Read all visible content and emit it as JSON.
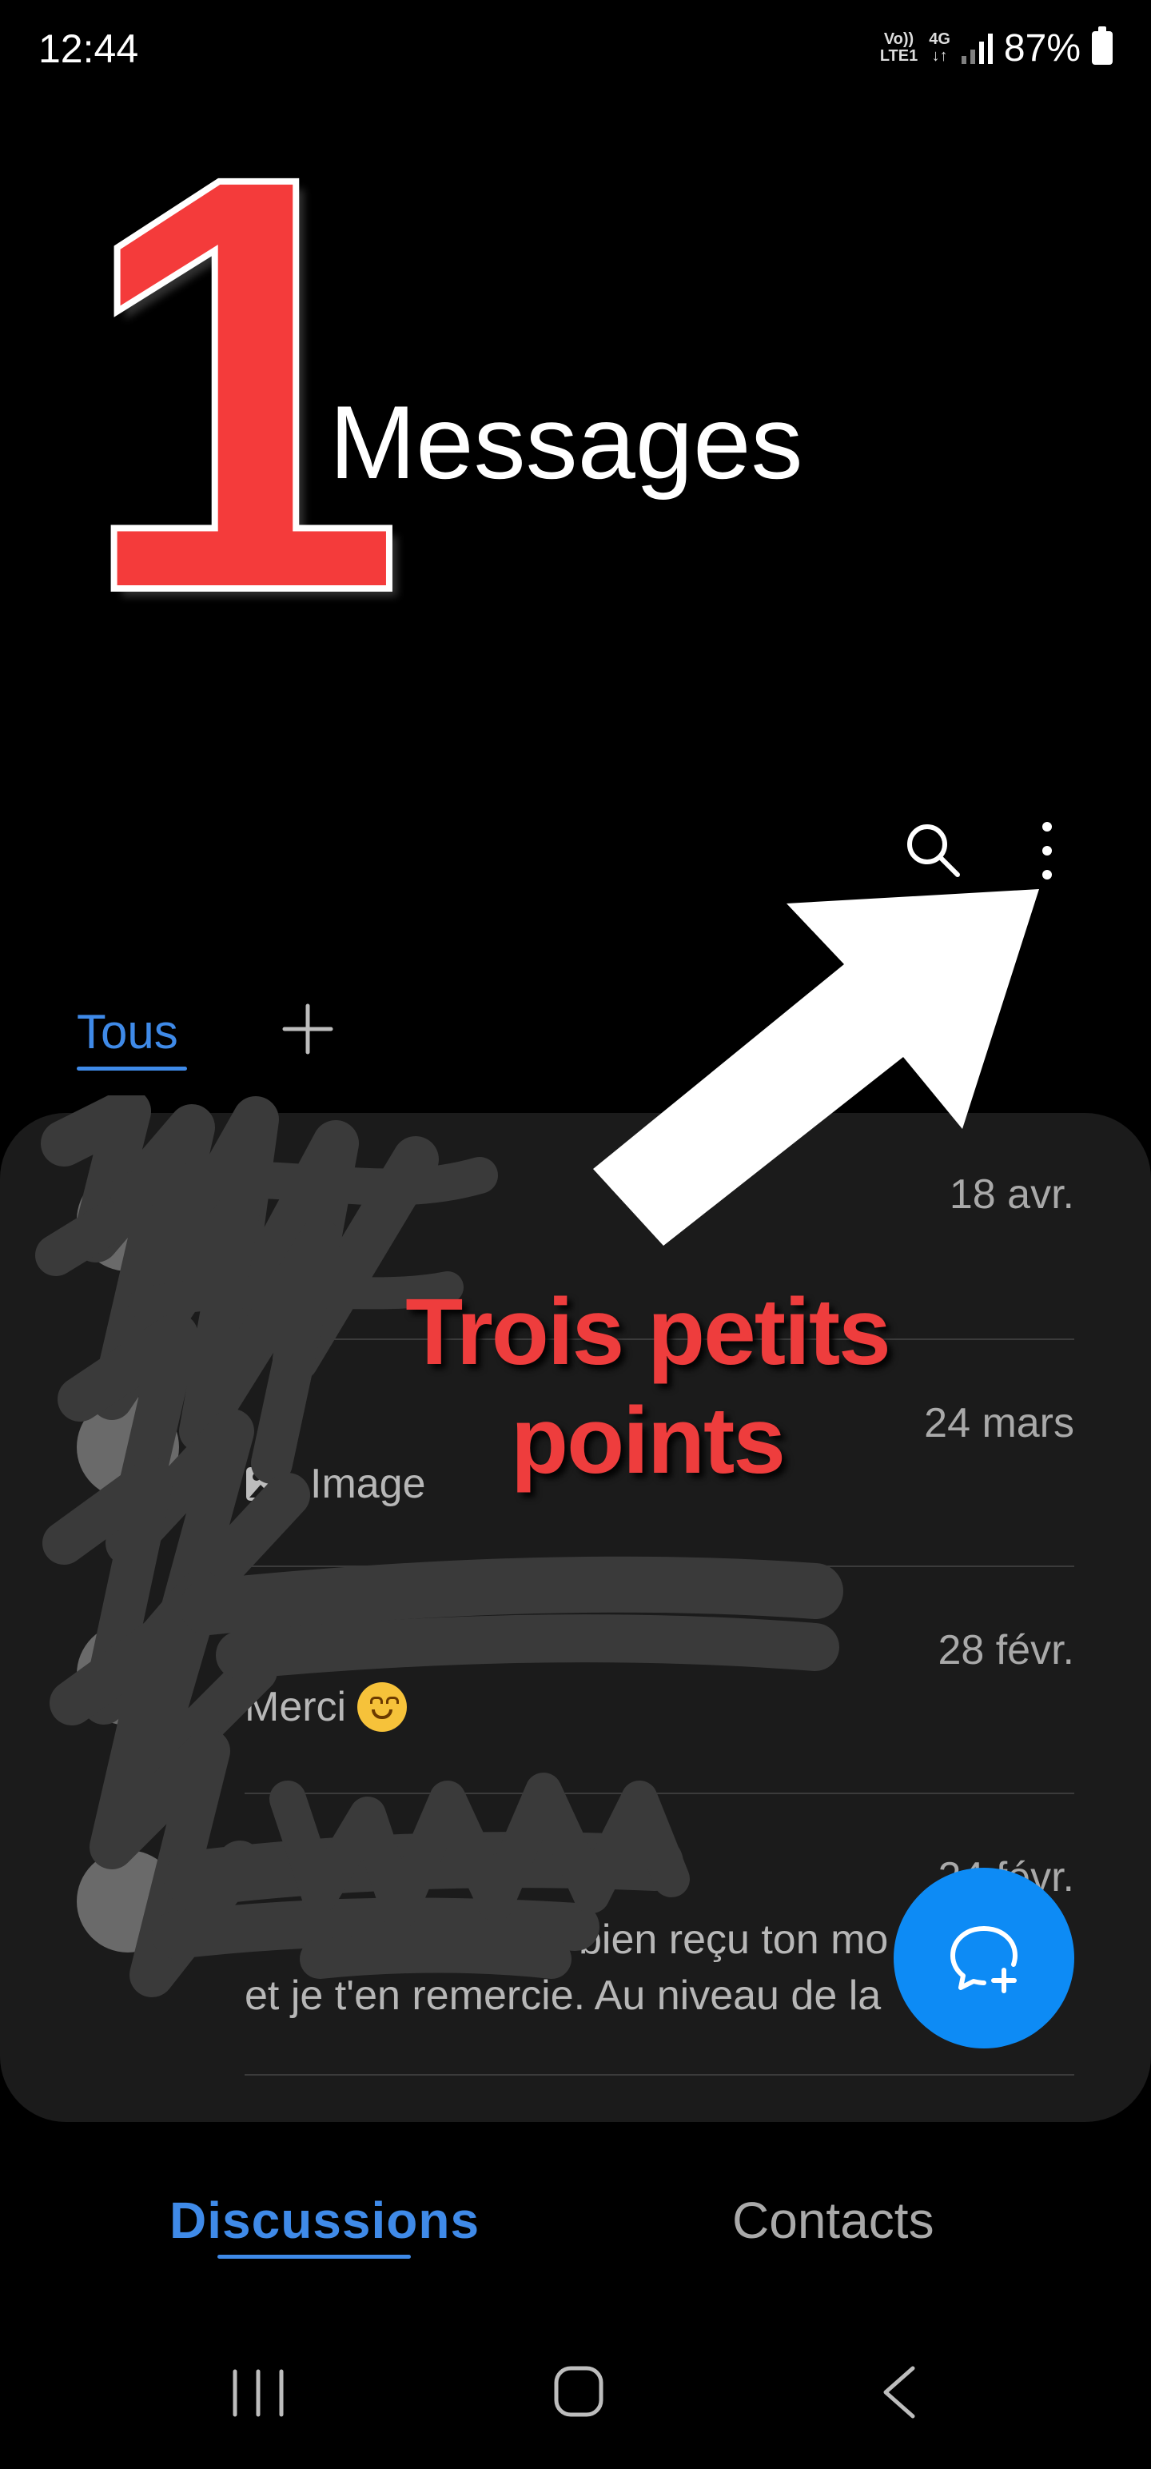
{
  "status_bar": {
    "time": "12:44",
    "volte_top": "Vo))",
    "volte_bottom": "LTE1",
    "network": "4G",
    "battery": "87%"
  },
  "header": {
    "step_number": "1",
    "title": "Messages",
    "search_icon": "search-icon",
    "more_icon": "more-vertical-icon"
  },
  "filter_tabs": {
    "active_label": "Tous",
    "add_icon": "plus-icon"
  },
  "conversations": [
    {
      "name": "",
      "date": "18 avr.",
      "preview": ""
    },
    {
      "name": "",
      "date": "24 mars",
      "preview": "Image"
    },
    {
      "name": "",
      "date": "28 févr.",
      "preview": "Merci"
    },
    {
      "name": "",
      "date": "24 févr.",
      "preview_line1": "bien reçu ton mo",
      "preview_line2": "et je t'en remercie. Au niveau de la"
    }
  ],
  "annotation": {
    "text_line1": "Trois petits",
    "text_line2": "points"
  },
  "fab": {
    "icon": "new-chat-icon"
  },
  "bottom_tabs": {
    "discussions": "Discussions",
    "contacts": "Contacts"
  },
  "colors": {
    "accent": "#3f8ae8",
    "fab": "#0d8bf5",
    "annotation_red": "#ee3d3d",
    "card_bg": "#1b1b1b"
  }
}
